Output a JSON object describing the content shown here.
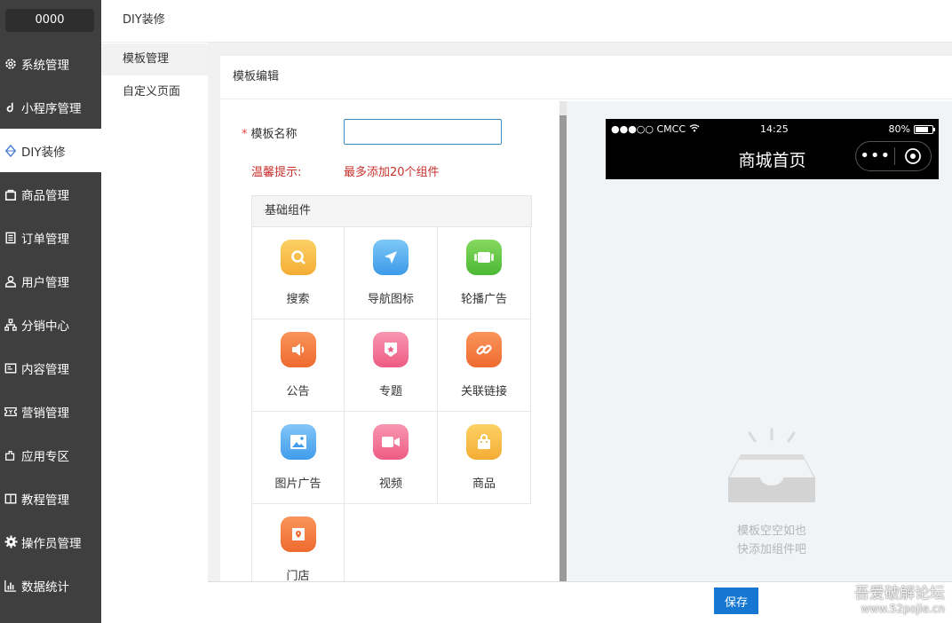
{
  "sidebar": {
    "brand": "0000",
    "items": [
      {
        "label": "系统管理",
        "icon": "gear-icon"
      },
      {
        "label": "小程序管理",
        "icon": "music-note-icon"
      },
      {
        "label": "DIY装修",
        "icon": "diamond-icon"
      },
      {
        "label": "商品管理",
        "icon": "bag-icon"
      },
      {
        "label": "订单管理",
        "icon": "document-icon"
      },
      {
        "label": "用户管理",
        "icon": "user-icon"
      },
      {
        "label": "分销中心",
        "icon": "org-chart-icon"
      },
      {
        "label": "内容管理",
        "icon": "content-icon"
      },
      {
        "label": "营销管理",
        "icon": "ticket-icon"
      },
      {
        "label": "应用专区",
        "icon": "puzzle-icon"
      },
      {
        "label": "教程管理",
        "icon": "book-icon"
      },
      {
        "label": "操作员管理",
        "icon": "settings-icon"
      },
      {
        "label": "数据统计",
        "icon": "bar-chart-icon"
      }
    ],
    "active": "DIY装修"
  },
  "subnav": {
    "heading": "DIY装修",
    "items": [
      {
        "label": "模板管理"
      },
      {
        "label": "自定义页面"
      }
    ]
  },
  "panel": {
    "title": "模板编辑",
    "name_label": "模板名称",
    "name_value": "",
    "tip_label": "温馨提示:",
    "tip_text": "最多添加20个组件",
    "components_heading": "基础组件",
    "components": [
      {
        "label": "搜索",
        "icon": "search-icon",
        "color": "#f5b73b"
      },
      {
        "label": "导航图标",
        "icon": "navigation-icon",
        "color": "#4aa8f0"
      },
      {
        "label": "轮播广告",
        "icon": "carousel-icon",
        "color": "#58c53a"
      },
      {
        "label": "公告",
        "icon": "speaker-icon",
        "color": "#f2773e"
      },
      {
        "label": "专题",
        "icon": "badge-icon",
        "color": "#f06c8e"
      },
      {
        "label": "关联链接",
        "icon": "link-icon",
        "color": "#f2773e"
      },
      {
        "label": "图片广告",
        "icon": "image-icon",
        "color": "#58a9f2"
      },
      {
        "label": "视频",
        "icon": "video-icon",
        "color": "#f06c8e"
      },
      {
        "label": "商品",
        "icon": "shopping-bag-icon",
        "color": "#f5b73b"
      },
      {
        "label": "门店",
        "icon": "store-icon",
        "color": "#f2773e"
      }
    ]
  },
  "preview": {
    "carrier": "●●●○○ CMCC",
    "time": "14:25",
    "battery": "80%",
    "page_title": "商城首页",
    "capsule_dots": "•••",
    "empty_line1": "模板空空如也",
    "empty_line2": "快添加组件吧"
  },
  "footer": {
    "save_label": "保存",
    "watermark_line1": "吾爱破解论坛",
    "watermark_line2": "www.52pojie.cn"
  }
}
